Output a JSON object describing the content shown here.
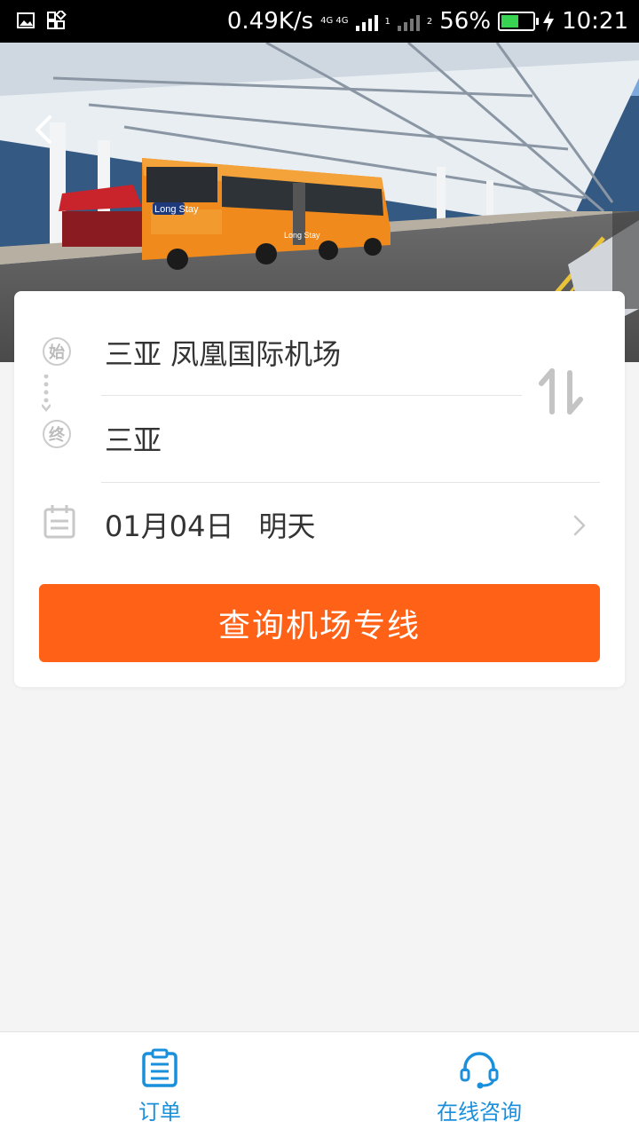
{
  "status_bar": {
    "speed": "0.49K/s",
    "network_label": "4G 4G",
    "sim1_label": "1",
    "sim2_label": "2",
    "battery_percent": "56%",
    "battery_level": 0.56,
    "time": "10:21"
  },
  "route": {
    "start_badge": "始",
    "end_badge": "终",
    "from": "三亚  凤凰国际机场",
    "to": "三亚"
  },
  "date": {
    "day": "01月04日",
    "relative": "明天"
  },
  "search_button": "查询机场专线",
  "tabs": [
    {
      "label": "订单",
      "icon": "order-icon"
    },
    {
      "label": "在线咨询",
      "icon": "headset-icon"
    }
  ],
  "hero_bus": {
    "ad_text": "Long Stay",
    "ad_text_small": "Long Stay"
  },
  "colors": {
    "accent": "#ff6217",
    "tab_blue": "#1a8fdb",
    "bus_orange": "#f08a1c"
  }
}
